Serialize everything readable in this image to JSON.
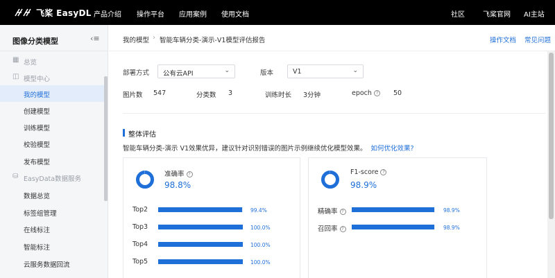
{
  "topnav": {
    "logo_text": "飞桨 EasyDL",
    "items": [
      "产品介绍",
      "操作平台",
      "应用案例",
      "使用文档"
    ],
    "right_items": [
      "社区",
      "飞桨官网",
      "AI主站"
    ]
  },
  "sidebar": {
    "title": "图像分类模型",
    "items": [
      {
        "label": "总览",
        "type": "group",
        "icon": "grid-icon"
      },
      {
        "label": "模型中心",
        "type": "group",
        "icon": "folder-icon"
      },
      {
        "label": "我的模型",
        "type": "item",
        "active": true
      },
      {
        "label": "创建模型",
        "type": "item"
      },
      {
        "label": "训练模型",
        "type": "item"
      },
      {
        "label": "校验模型",
        "type": "item"
      },
      {
        "label": "发布模型",
        "type": "item"
      },
      {
        "label": "EasyData数据服务",
        "type": "group",
        "icon": "database-icon"
      },
      {
        "label": "数据总览",
        "type": "item"
      },
      {
        "label": "标签组管理",
        "type": "item"
      },
      {
        "label": "在线标注",
        "type": "item"
      },
      {
        "label": "智能标注",
        "type": "item"
      },
      {
        "label": "云服务数据回流",
        "type": "item"
      }
    ]
  },
  "breadcrumb": {
    "root": "我的模型",
    "current": "智能车辆分类-演示-V1模型评估报告",
    "links": [
      "操作文档",
      "常见问题"
    ]
  },
  "filters": {
    "deploy_label": "部署方式",
    "deploy_value": "公有云API",
    "version_label": "版本",
    "version_value": "V1"
  },
  "meta": {
    "images_label": "图片数",
    "images_value": "547",
    "classes_label": "分类数",
    "classes_value": "3",
    "duration_label": "训练时长",
    "duration_value": "3分钟",
    "epoch_label": "epoch",
    "epoch_value": "50"
  },
  "evaluation": {
    "section_title": "整体评估",
    "description": "智能车辆分类-演示 V1效果优异，建议针对识别错误的图片示例继续优化模型效果。",
    "optimize_link": "如何优化效果?",
    "accuracy": {
      "name": "准确率",
      "value": "98.8%",
      "fraction": 0.988,
      "rows": [
        {
          "label": "Top2",
          "value": "99.4%",
          "fraction": 0.994
        },
        {
          "label": "Top3",
          "value": "100.0%",
          "fraction": 1.0
        },
        {
          "label": "Top4",
          "value": "100.0%",
          "fraction": 1.0
        },
        {
          "label": "Top5",
          "value": "100.0%",
          "fraction": 1.0
        }
      ]
    },
    "f1": {
      "name": "F1-score",
      "value": "98.9%",
      "fraction": 0.989,
      "rows": [
        {
          "label": "精确率",
          "value": "98.9%",
          "fraction": 0.989
        },
        {
          "label": "召回率",
          "value": "98.9%",
          "fraction": 0.989
        }
      ]
    }
  },
  "colors": {
    "accent": "#1f6fd8",
    "topbar": "#000000"
  }
}
